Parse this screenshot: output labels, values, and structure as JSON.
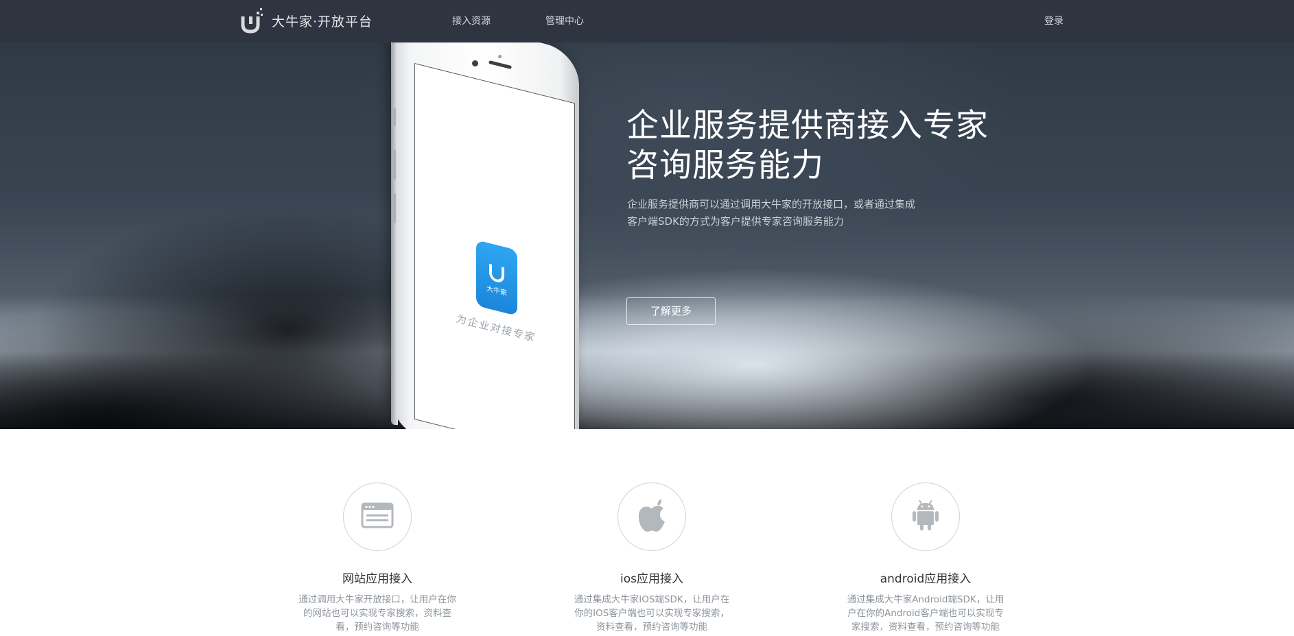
{
  "brand": {
    "name": "大牛家·开放平台",
    "logo_icon": "daniujia-logo-icon"
  },
  "nav": {
    "items": [
      {
        "label": "接入资源"
      },
      {
        "label": "管理中心"
      }
    ],
    "login_label": "登录"
  },
  "hero": {
    "title_line1": "企业服务提供商接入专家",
    "title_line2": "咨询服务能力",
    "desc_line1": "企业服务提供商可以通过调用大牛家的开放接口，或者通过集成",
    "desc_line2": "客户端SDK的方式为客户提供专家咨询服务能力",
    "button_label": "了解更多",
    "phone": {
      "app_name": "大牛家",
      "slogan": "为企业对接专家"
    }
  },
  "features": [
    {
      "icon": "browser-window-icon",
      "title": "网站应用接入",
      "desc_lines": [
        "通过调用大牛家开放接口，让用户在你",
        "的网站也可以实现专家搜索，资料查",
        "看，预约咨询等功能"
      ]
    },
    {
      "icon": "apple-icon",
      "title": "ios应用接入",
      "desc_lines": [
        "通过集成大牛家IOS端SDK，让用户在",
        "你的IOS客户端也可以实现专家搜索，",
        "资料查看，预约咨询等功能"
      ]
    },
    {
      "icon": "android-icon",
      "title": "android应用接入",
      "desc_lines": [
        "通过集成大牛家Android端SDK，让用",
        "户在你的Android客户端也可以实现专",
        "家搜索，资料查看，预约咨询等功能"
      ]
    }
  ],
  "colors": {
    "nav_bg": "#2e3540",
    "icon_gray": "#b3b8bd",
    "app_blue": "#2196f3"
  }
}
